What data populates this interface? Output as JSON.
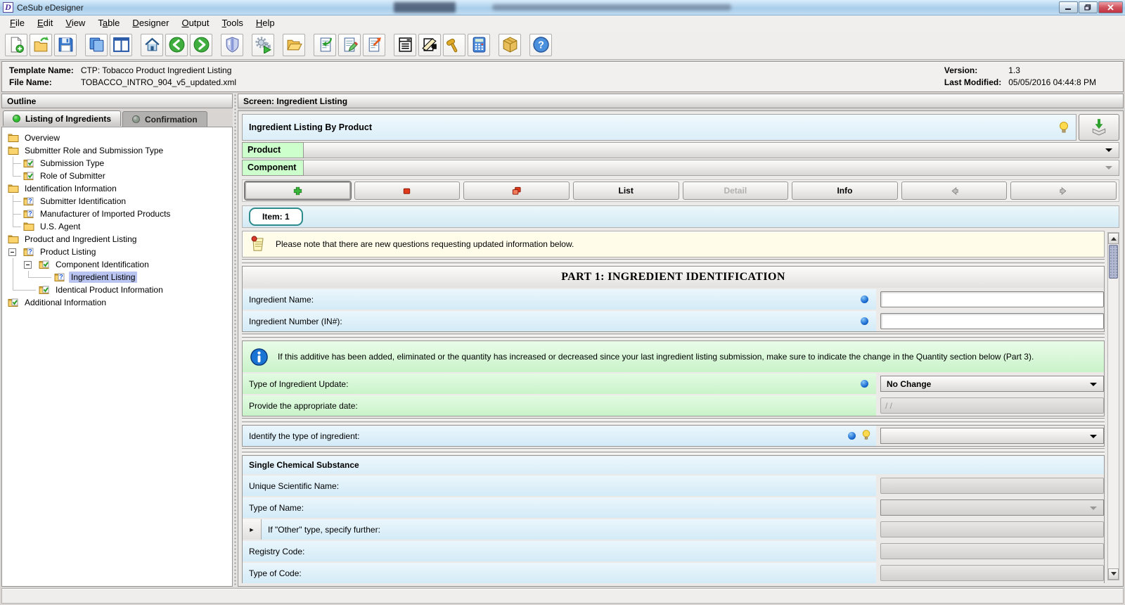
{
  "window": {
    "title": "CeSub eDesigner",
    "icon_letter": "D",
    "controls": [
      {
        "name": "minimize"
      },
      {
        "name": "maximize"
      },
      {
        "name": "close"
      }
    ]
  },
  "menu": {
    "items": [
      {
        "label": "File",
        "underline": 0
      },
      {
        "label": "Edit",
        "underline": 0
      },
      {
        "label": "View",
        "underline": 0
      },
      {
        "label": "Table",
        "underline": 1
      },
      {
        "label": "Designer",
        "underline": 0
      },
      {
        "label": "Output",
        "underline": 0
      },
      {
        "label": "Tools",
        "underline": 0
      },
      {
        "label": "Help",
        "underline": 0
      }
    ]
  },
  "toolbar": {
    "groups": [
      [
        "new-document-icon",
        "open-template-icon",
        "save-icon"
      ],
      [
        "duplicate-view-icon",
        "split-view-icon"
      ],
      [
        "home-icon",
        "back-icon",
        "forward-icon"
      ],
      [
        "validate-shield-icon"
      ],
      [
        "generate-gears-icon"
      ],
      [
        "open-folder-icon"
      ],
      [
        "import-document-icon",
        "edit-document-icon",
        "export-document-icon"
      ],
      [
        "form-view-icon",
        "page-setup-icon",
        "gavel-icon",
        "calculator-icon"
      ],
      [
        "package-icon"
      ],
      [
        "help-icon"
      ]
    ]
  },
  "template_info": {
    "template_name_label": "Template Name:",
    "template_name": "CTP: Tobacco Product Ingredient Listing",
    "file_name_label": "File Name:",
    "file_name": "TOBACCO_INTRO_904_v5_updated.xml",
    "version_label": "Version:",
    "version": "1.3",
    "last_modified_label": "Last Modified:",
    "last_modified": "05/05/2016 04:44:8 PM"
  },
  "outline": {
    "header": "Outline",
    "tabs": [
      {
        "label": "Listing of Ingredients",
        "active": true,
        "dot_color": "#2fbf2f"
      },
      {
        "label": "Confirmation",
        "active": false,
        "dot_color": "#8c988c"
      }
    ],
    "tree": [
      {
        "label": "Overview",
        "icon": "folder-icon",
        "cells": []
      },
      {
        "label": "Submitter Role and Submission Type",
        "icon": "folder-icon",
        "cells": []
      },
      {
        "label": "Submission Type",
        "icon": "check-icon",
        "cells": [
          "tee"
        ]
      },
      {
        "label": "Role of Submitter",
        "icon": "check-icon",
        "cells": [
          "el"
        ]
      },
      {
        "label": "Identification Information",
        "icon": "folder-icon",
        "cells": []
      },
      {
        "label": "Submitter Identification",
        "icon": "question-icon",
        "cells": [
          "tee"
        ]
      },
      {
        "label": "Manufacturer of Imported Products",
        "icon": "question-icon",
        "cells": [
          "tee"
        ]
      },
      {
        "label": "U.S. Agent",
        "icon": "folder-icon",
        "cells": [
          "el"
        ]
      },
      {
        "label": "Product and Ingredient Listing",
        "icon": "folder-icon",
        "cells": []
      },
      {
        "label": "Product Listing",
        "icon": "question-icon",
        "cells": [
          "exp"
        ]
      },
      {
        "label": "Component Identification",
        "icon": "check-icon",
        "cells": [
          "vl",
          "exp"
        ]
      },
      {
        "label": "Ingredient Listing",
        "icon": "question-icon",
        "cells": [
          "vl",
          "elw"
        ],
        "selected": true
      },
      {
        "label": "Identical Product Information",
        "icon": "check-icon",
        "cells": [
          "elw"
        ]
      },
      {
        "label": "Additional Information",
        "icon": "check-icon",
        "cells": []
      }
    ]
  },
  "screen": {
    "header": "Screen: Ingredient Listing",
    "title_bar": {
      "label": "Ingredient Listing By Product",
      "bulb_icon": "bulb-icon"
    },
    "download_button": {
      "icon": "download-icon"
    },
    "selectors": [
      {
        "label": "Product",
        "enabled": true
      },
      {
        "label": "Component",
        "enabled": false
      }
    ],
    "action_buttons": [
      {
        "name": "add",
        "icon": "plus-icon",
        "enabled": true,
        "focused": true
      },
      {
        "name": "remove",
        "icon": "minus-icon",
        "enabled": true
      },
      {
        "name": "copy",
        "icon": "copy-icon",
        "enabled": true
      },
      {
        "name": "list",
        "label": "List",
        "enabled": true
      },
      {
        "name": "detail",
        "label": "Detail",
        "enabled": false
      },
      {
        "name": "info",
        "label": "Info",
        "enabled": true
      },
      {
        "name": "previous",
        "icon": "arrow-left-icon",
        "enabled": false
      },
      {
        "name": "next",
        "icon": "arrow-right-icon",
        "enabled": false
      }
    ],
    "item_tab": "Item: 1"
  },
  "form": {
    "groups": [
      {
        "type": "note",
        "icon": "note-pin-icon",
        "text": "Please note that there are new questions requesting updated information below."
      },
      {
        "type": "box",
        "rows": [
          {
            "kind": "header",
            "text": "PART 1: INGREDIENT IDENTIFICATION"
          },
          {
            "kind": "field",
            "label": "Ingredient Name:",
            "bg": "blue",
            "dot": true,
            "control": "input",
            "enabled": true,
            "value": ""
          },
          {
            "kind": "field",
            "label": "Ingredient Number (IN#):",
            "bg": "blue",
            "dot": true,
            "control": "input",
            "enabled": true,
            "value": ""
          }
        ]
      },
      {
        "type": "box",
        "rows": [
          {
            "kind": "info",
            "icon": "info-circle-icon",
            "text": "If this additive has been added, eliminated or the quantity has increased or decreased since your last ingredient listing submission, make sure to indicate the change in the Quantity section below (Part 3)."
          },
          {
            "kind": "field",
            "label": "Type of Ingredient Update:",
            "bg": "green",
            "dot": true,
            "control": "select",
            "enabled": true,
            "value": "No Change"
          },
          {
            "kind": "field",
            "label": "Provide the appropriate date:",
            "bg": "green",
            "control": "input",
            "enabled": false,
            "value": "/  /"
          }
        ]
      },
      {
        "type": "box",
        "rows": [
          {
            "kind": "field",
            "label": "Identify the type of ingredient:",
            "bg": "blue",
            "dot": true,
            "bulb": true,
            "control": "select",
            "enabled": true,
            "value": ""
          }
        ]
      },
      {
        "type": "box",
        "rows": [
          {
            "kind": "section",
            "text": "Single Chemical Substance"
          },
          {
            "kind": "field",
            "label": "Unique Scientific Name:",
            "bg": "blue",
            "control": "input",
            "enabled": false,
            "value": ""
          },
          {
            "kind": "field",
            "label": "Type of Name:",
            "bg": "blue",
            "control": "select",
            "enabled": false,
            "value": ""
          },
          {
            "kind": "field",
            "label": "If \"Other\" type, specify further:",
            "bg": "blue",
            "subarrow": true,
            "control": "input",
            "enabled": false,
            "value": ""
          },
          {
            "kind": "field",
            "label": "Registry Code:",
            "bg": "blue",
            "control": "input",
            "enabled": false,
            "value": ""
          },
          {
            "kind": "field",
            "label": "Type of Code:",
            "bg": "blue",
            "control": "input",
            "enabled": false,
            "value": ""
          }
        ]
      }
    ]
  },
  "colors": {
    "row_blue": "#d9edf8",
    "row_green": "#cdf3cd",
    "selector_green": "#ccffcc",
    "tree_selection": "#b9c5f0",
    "active_tab_dot": "#2fbf2f",
    "note_bg": "#fffdea",
    "required_dot": "#1a6ad0"
  }
}
